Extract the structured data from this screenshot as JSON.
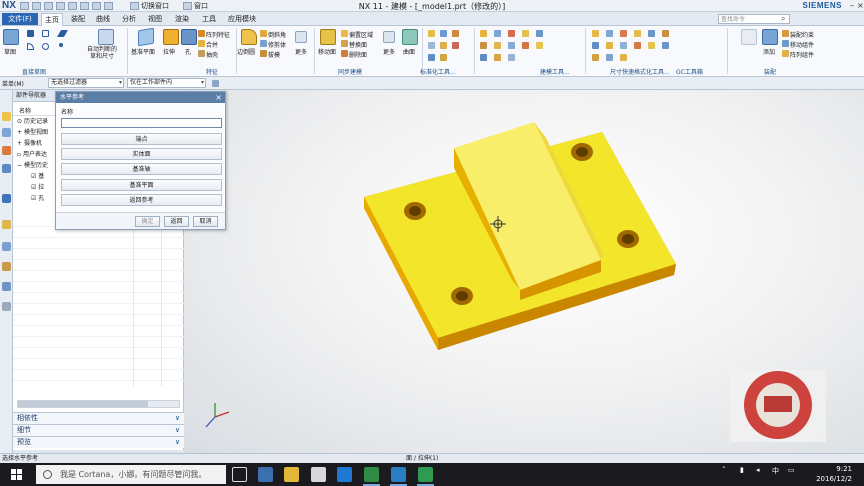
{
  "titlebar": {
    "app": "NX",
    "qa_label_1": "切换窗口",
    "qa_label_2": "窗口",
    "title": "NX 11 - 建模 - [_model1.prt（修改的）]",
    "brand": "SIEMENS"
  },
  "menubar": {
    "file": "文件(F)",
    "tabs": [
      "主页",
      "装配",
      "曲线",
      "分析",
      "视图",
      "渲染",
      "工具",
      "应用模块"
    ],
    "active_tab": "主页",
    "search_placeholder": "查找命令"
  },
  "ribbon": {
    "sketch": "草图",
    "dimension": "自动判断的\n草和尺寸",
    "datum_plane": "基准平面",
    "extrude": "拉伸",
    "hole": "孔",
    "pattern_feature": "阵列特征",
    "unite": "合并",
    "shell": "抽壳",
    "edge_blend": "边倒圆",
    "chamfer": "倒斜角",
    "trim_body": "修剪体",
    "draft": "拔模",
    "more1": "更多",
    "move_face": "移动面",
    "delete_face": "偏置区域",
    "replace_face": "替换面",
    "delete_face2": "删除面",
    "more2": "更多",
    "surface": "曲面",
    "assemble": "装配约束",
    "move_component": "移动组件",
    "pattern_component": "阵列组件",
    "add": "添加",
    "groups": [
      "直接草图",
      "特征",
      "同步建模",
      "标准化工具...",
      "建模工具...",
      "尺寸快速格式化工具...",
      "GC工具箱",
      "装配"
    ]
  },
  "selbar": {
    "menu": "菜单(M)",
    "filter": "无选择过滤器",
    "scope": "仅在工作部件内"
  },
  "navigator": {
    "title": "部件导航器",
    "col_name": "名称",
    "rows": [
      "历史记录",
      "模型视图",
      "摄像机",
      "用户表达",
      "模型历史",
      "基",
      "拉",
      "孔"
    ],
    "sections": [
      "相依性",
      "细节",
      "预览"
    ]
  },
  "dialog": {
    "title": "水平参考",
    "name_label": "名称",
    "options": [
      "端点",
      "实体面",
      "基准轴",
      "基准平面",
      "返回参考"
    ],
    "ok": "确定",
    "back": "返回",
    "cancel": "取消"
  },
  "statusbar": {
    "message": "选择水平参考",
    "info": "面 / 拉伸(1)"
  },
  "taskbar": {
    "cortana": "我是 Cortana，小娜。有问题尽管问我。",
    "time": "9:21",
    "date": "2016/12/2"
  },
  "colors": {
    "accent": "#2b66b5",
    "part_yellow": "#f3e62a",
    "part_side": "#e2a400"
  }
}
